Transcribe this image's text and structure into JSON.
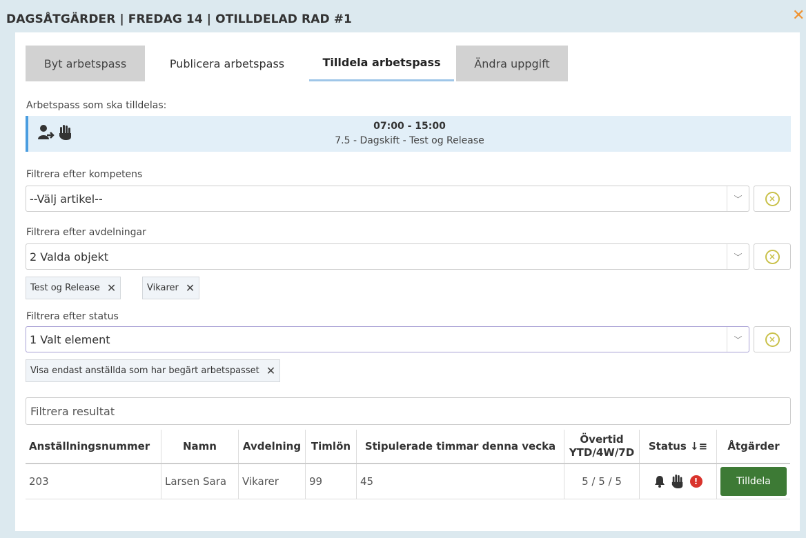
{
  "dialog": {
    "title": "DAGSÅTGÄRDER | FREDAG 14 | OTILLDELAD RAD #1",
    "close_icon": "✕"
  },
  "tabs": [
    {
      "label": "Byt arbetspass"
    },
    {
      "label": "Publicera arbetspass"
    },
    {
      "label": "Tilldela arbetspass"
    },
    {
      "label": "Ändra uppgift"
    }
  ],
  "shift": {
    "label": "Arbetspass som ska tilldelas:",
    "time": "07:00 - 15:00",
    "description": "7.5 - Dagskift - Test og Release",
    "icons": [
      "user-transfer-icon",
      "hand-icon"
    ]
  },
  "filters": {
    "competence": {
      "label": "Filtrera efter kompetens",
      "value": "--Välj artikel--"
    },
    "departments": {
      "label": "Filtrera efter avdelningar",
      "value": "2 Valda objekt",
      "chips": [
        "Test og Release",
        "Vikarer"
      ]
    },
    "status": {
      "label": "Filtrera efter status",
      "value": "1 Valt element",
      "chips": [
        "Visa endast anställda som har begärt arbetspasset"
      ]
    }
  },
  "results_filter": {
    "placeholder": "Filtrera resultat"
  },
  "table": {
    "headers": {
      "employee_number": "Anställningsnummer",
      "name": "Namn",
      "department": "Avdelning",
      "hourly_wage": "Timlön",
      "stipulated": "Stipulerade timmar denna vecka",
      "overtime_line1": "Övertid",
      "overtime_line2": "YTD/4W/7D",
      "status": "Status",
      "actions": "Åtgärder"
    },
    "rows": [
      {
        "employee_number": "203",
        "name": "Larsen Sara",
        "department": "Vikarer",
        "hourly_wage": "99",
        "stipulated": "45",
        "overtime": "5 / 5 / 5",
        "status_icons": [
          "bell-icon",
          "hand-icon",
          "error-icon"
        ],
        "action": "Tilldela"
      }
    ]
  }
}
